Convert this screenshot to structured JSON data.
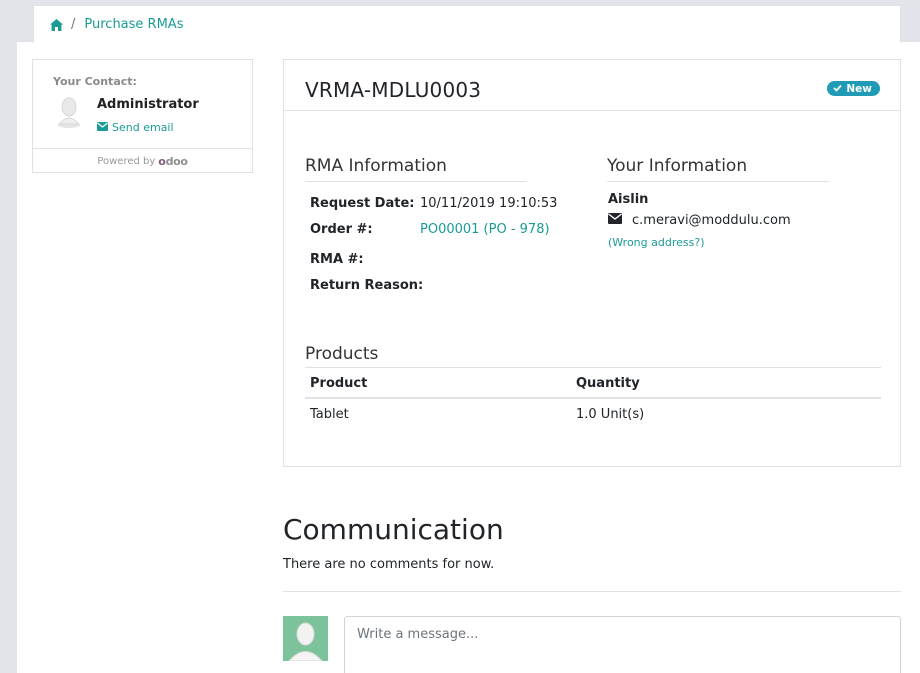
{
  "breadcrumb": {
    "home_icon": "home-icon",
    "separator": "/",
    "current": "Purchase RMAs"
  },
  "contact": {
    "label": "Your Contact:",
    "name": "Administrator",
    "send_email": "Send email",
    "powered_by": "Powered by",
    "logo_text_1": "o",
    "logo_text_2": "doo"
  },
  "rma": {
    "title": "VRMA-MDLU0003",
    "status": "New",
    "info_title": "RMA Information",
    "your_info_title": "Your Information",
    "fields": [
      {
        "label": "Request Date:",
        "value": "10/11/2019 19:10:53"
      },
      {
        "label": "Order #:",
        "value": "PO00001 (PO - 978)"
      },
      {
        "label": "RMA #:",
        "value": ""
      },
      {
        "label": "Return Reason:",
        "value": ""
      }
    ],
    "customer_name": "Aislin",
    "customer_email": "c.meravi@moddulu.com",
    "wrong_address": "(Wrong address?)",
    "products_title": "Products",
    "columns": [
      "Product",
      "Quantity"
    ],
    "rows": [
      {
        "product": "Tablet",
        "quantity": "1.0 Unit(s)"
      }
    ]
  },
  "communication": {
    "title": "Communication",
    "empty_text": "There are no comments for now.",
    "placeholder": "Write a message..."
  },
  "colors": {
    "accent": "#1a9b95",
    "badge": "#1f9bb5",
    "avatar_bg": "#7cc39b"
  }
}
